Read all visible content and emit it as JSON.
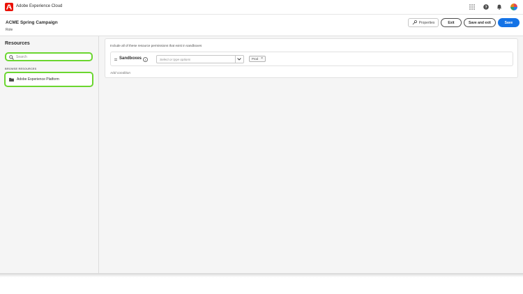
{
  "topbar": {
    "app_name": "Adobe Experience Cloud",
    "icons": [
      "apps-grid-icon",
      "help-icon",
      "notifications-bell-icon",
      "user-avatar"
    ]
  },
  "header": {
    "title": "ACME Spring Campaign",
    "subtitle": "Role",
    "properties_label": "Properties",
    "exit_label": "Exit",
    "save_exit_label": "Save and exit",
    "save_label": "Save"
  },
  "sidebar": {
    "title": "Resources",
    "search_placeholder": "Search",
    "section_label": "BROWSE RESOURCES",
    "items": [
      {
        "label": "Adobe Experience Platform",
        "icon": "folder-icon"
      }
    ]
  },
  "main": {
    "description": "Include all of these resource permissions that exist in sandboxes",
    "condition": {
      "label": "Sandboxes",
      "select_placeholder": "Select or type options",
      "tags": [
        {
          "label": "Prod"
        }
      ]
    },
    "add_condition_label": "Add condition"
  },
  "colors": {
    "brand": "#eb1000",
    "primary_button": "#1473e6",
    "highlight_outline": "#6bd62f"
  }
}
